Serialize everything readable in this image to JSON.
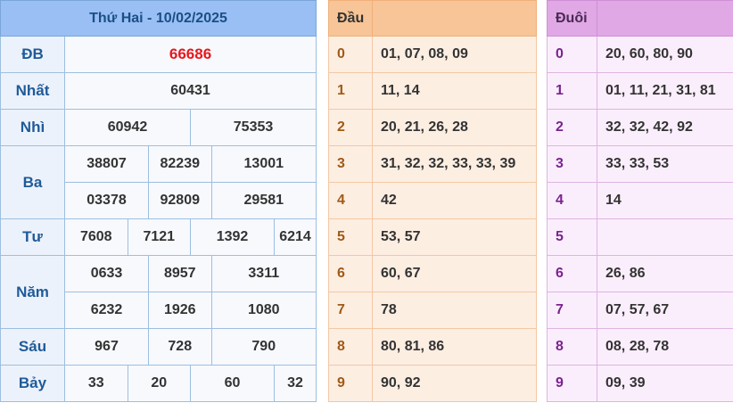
{
  "header": {
    "date_title": "Thứ Hai - 10/02/2025"
  },
  "prizes": {
    "db": {
      "label": "ĐB",
      "numbers": [
        "66686"
      ]
    },
    "nhat": {
      "label": "Nhất",
      "numbers": [
        "60431"
      ]
    },
    "nhi": {
      "label": "Nhì",
      "numbers": [
        "60942",
        "75353"
      ]
    },
    "ba": {
      "label": "Ba",
      "numbers": [
        "38807",
        "82239",
        "13001",
        "03378",
        "92809",
        "29581"
      ]
    },
    "tu": {
      "label": "Tư",
      "numbers": [
        "7608",
        "7121",
        "1392",
        "6214"
      ]
    },
    "nam": {
      "label": "Năm",
      "numbers": [
        "0633",
        "8957",
        "3311",
        "6232",
        "1926",
        "1080"
      ]
    },
    "sau": {
      "label": "Sáu",
      "numbers": [
        "967",
        "728",
        "790"
      ]
    },
    "bay": {
      "label": "Bảy",
      "numbers": [
        "33",
        "20",
        "60",
        "32"
      ]
    }
  },
  "head": {
    "title": "Đầu",
    "rows": [
      {
        "digit": "0",
        "values": "01, 07, 08, 09"
      },
      {
        "digit": "1",
        "values": "11, 14"
      },
      {
        "digit": "2",
        "values": "20, 21, 26, 28"
      },
      {
        "digit": "3",
        "values": "31, 32, 32, 33, 33, 39"
      },
      {
        "digit": "4",
        "values": "42"
      },
      {
        "digit": "5",
        "values": "53, 57"
      },
      {
        "digit": "6",
        "values": "60, 67"
      },
      {
        "digit": "7",
        "values": "78"
      },
      {
        "digit": "8",
        "values": "80, 81, 86"
      },
      {
        "digit": "9",
        "values": "90, 92"
      }
    ]
  },
  "tail": {
    "title": "Đuôi",
    "rows": [
      {
        "digit": "0",
        "values": "20, 60, 80, 90"
      },
      {
        "digit": "1",
        "values": "01, 11, 21, 31, 81"
      },
      {
        "digit": "2",
        "values": "32, 32, 42, 92"
      },
      {
        "digit": "3",
        "values": "33, 33, 53"
      },
      {
        "digit": "4",
        "values": "14"
      },
      {
        "digit": "5",
        "values": ""
      },
      {
        "digit": "6",
        "values": "26, 86"
      },
      {
        "digit": "7",
        "values": "07, 57, 67"
      },
      {
        "digit": "8",
        "values": "08, 28, 78"
      },
      {
        "digit": "9",
        "values": "09, 39"
      }
    ]
  },
  "colors": {
    "results_header": "#99bff5",
    "head_header": "#f7c597",
    "tail_header": "#e1a8e6",
    "special_prize": "#e8171c"
  }
}
